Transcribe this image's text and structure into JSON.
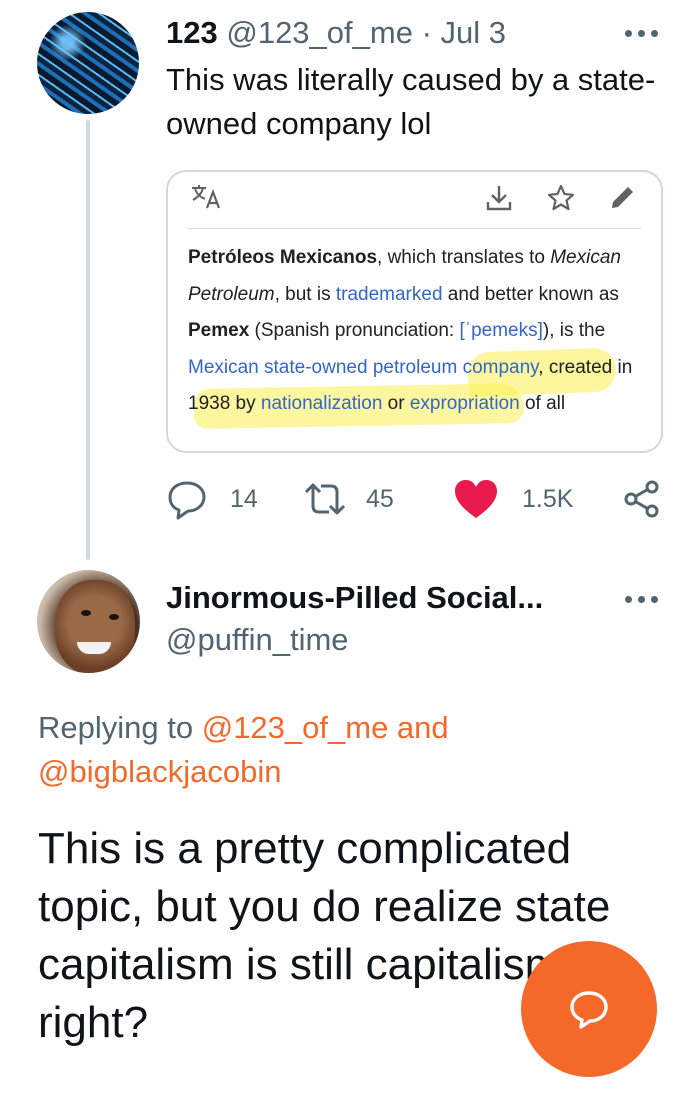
{
  "tweet1": {
    "name": "123",
    "handle": "@123_of_me",
    "separator": "·",
    "date": "Jul 3",
    "text": "This was literally caused by a state-owned company lol",
    "card": {
      "seg1": "Petróleos Mexicanos",
      "seg2": ", which translates to ",
      "seg3": "Mexican Petroleum",
      "seg4": ", but is ",
      "seg5": "trademarked",
      "seg6": " and better known as ",
      "seg7": "Pemex",
      "seg8": " (Spanish pronunciation: ",
      "seg9": "[ˈpemeks]",
      "seg10": "), is the ",
      "seg11": "Mexican state-owned petroleum company",
      "seg12": ", created in 1938 by ",
      "seg13": "nationalization",
      "seg14": " or ",
      "seg15": "expropriation",
      "seg16": " of all"
    },
    "actions": {
      "replies": "14",
      "retweets": "45",
      "likes": "1.5K"
    }
  },
  "tweet2": {
    "name": "Jinormous-Pilled Social...",
    "handle": "@puffin_time",
    "replying_prefix": "Replying to ",
    "replying_user1": "@123_of_me",
    "replying_and": " and ",
    "replying_user2": "@bigblackjacobin",
    "text": "This is a pretty complicated topic, but you do realize state capitalism is still capitalism right?"
  },
  "colors": {
    "accent": "#f4692a",
    "like": "#f91880",
    "secondary_text": "#536471",
    "link_blue": "#3366cc",
    "highlight": "#faf050"
  },
  "icons": {
    "translate": "translate-icon",
    "download": "download-icon",
    "star": "star-icon",
    "edit": "pencil-icon",
    "reply": "reply-icon",
    "retweet": "retweet-icon",
    "like": "heart-icon",
    "share": "share-icon",
    "more": "more-icon",
    "compose": "reply-bubble-icon"
  }
}
